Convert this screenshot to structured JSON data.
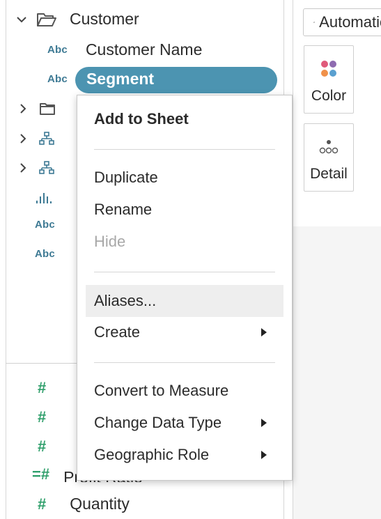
{
  "data_pane": {
    "folder": {
      "label": "Customer",
      "icon": "folder-open-icon"
    },
    "fields": [
      {
        "type": "Abc",
        "label": "Customer Name"
      },
      {
        "type": "Abc",
        "label": "Segment"
      }
    ],
    "type_labels": [
      "Abc",
      "Abc"
    ],
    "partial_field": "Profit Ratio",
    "quantity": "Quantity"
  },
  "marks": {
    "mark_type": "Automatic",
    "color_label": "Color",
    "detail_label": "Detail",
    "color_dots": [
      "#e05a7a",
      "#8e6bb0",
      "#f0914a",
      "#5aa0d0"
    ]
  },
  "context_menu": {
    "add_to_sheet": "Add to Sheet",
    "duplicate": "Duplicate",
    "rename": "Rename",
    "hide": "Hide",
    "aliases": "Aliases...",
    "create": "Create",
    "convert_to_measure": "Convert to Measure",
    "change_data_type": "Change Data Type",
    "geographic_role": "Geographic Role"
  },
  "colors": {
    "accent": "#4c94b1",
    "dimension": "#3e7a94",
    "measure": "#2f9f6b"
  }
}
